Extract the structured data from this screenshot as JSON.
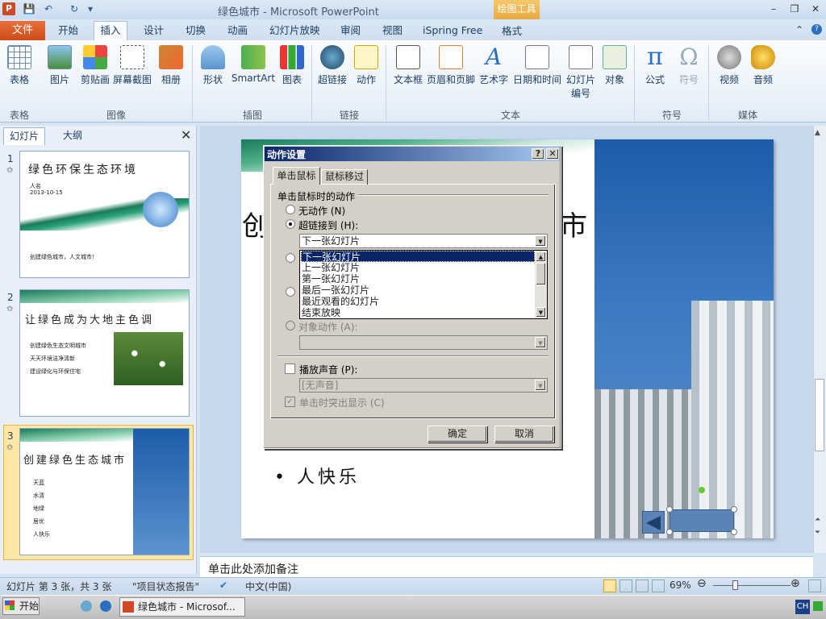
{
  "window": {
    "title": "绿色城市 - Microsoft PowerPoint",
    "contextual_tab": "绘图工具",
    "app_letter": "P"
  },
  "tabs": [
    "文件",
    "开始",
    "插入",
    "设计",
    "切换",
    "动画",
    "幻灯片放映",
    "审阅",
    "视图",
    "iSpring Free",
    "格式"
  ],
  "ribbon": {
    "buttons": [
      "表格",
      "图片",
      "剪贴画",
      "屏幕截图",
      "相册",
      "形状",
      "SmartArt",
      "图表",
      "超链接",
      "动作",
      "文本框",
      "页眉和页脚",
      "艺术字",
      "日期和时间",
      "幻灯片\n编号",
      "对象",
      "公式",
      "符号",
      "视频",
      "音频"
    ],
    "groups": [
      "表格",
      "图像",
      "插图",
      "链接",
      "文本",
      "符号",
      "媒体"
    ]
  },
  "pane": {
    "tab_slides": "幻灯片",
    "tab_outline": "大纲",
    "close": "✕"
  },
  "thumbs": [
    {
      "num": "1",
      "title": "绿色环保生态环境",
      "sub1": "人名",
      "sub2": "2013-10-15",
      "footer": "创建绿色城市，人文城市！"
    },
    {
      "num": "2",
      "title": "让绿色成为大地主色调",
      "bullets": [
        "创建绿色生态文明城市",
        "天天环境洁净清新",
        "建设绿化与环保住宅"
      ]
    },
    {
      "num": "3",
      "title": "创建绿色生态城市",
      "bullets": [
        "天蓝",
        "水清",
        "地绿",
        "居优",
        "人快乐"
      ]
    }
  ],
  "slide": {
    "title_left": "创",
    "title_right": "市",
    "bullet": "人快乐"
  },
  "dialog": {
    "title": "动作设置",
    "help": "?",
    "close": "✕",
    "tab_click": "单击鼠标",
    "tab_hover": "鼠标移过",
    "section": "单击鼠标时的动作",
    "opt_none": "无动作 (N)",
    "opt_link": "超链接到 (H):",
    "link_value": "下一张幻灯片",
    "list": [
      "下一张幻灯片",
      "上一张幻灯片",
      "第一张幻灯片",
      "最后一张幻灯片",
      "最近观看的幻灯片",
      "结束放映"
    ],
    "opt_object": "对象动作 (A):",
    "play_sound": "播放声音 (P):",
    "sound_value": "[无声音]",
    "highlight": "单击时突出显示 (C)",
    "ok": "确定",
    "cancel": "取消"
  },
  "notes": "单击此处添加备注",
  "status": {
    "slide": "幻灯片 第 3 张，共 3 张",
    "theme": "\"项目状态报告\"",
    "lang": "中文(中国)",
    "zoom": "69%"
  },
  "taskbar": {
    "start": "开始",
    "task": "绿色城市 - Microsof...",
    "ime": "CH"
  }
}
